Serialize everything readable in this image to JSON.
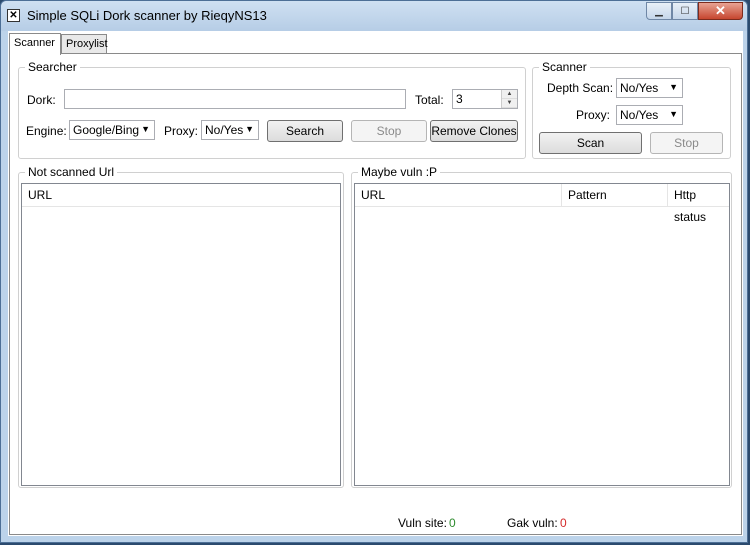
{
  "window": {
    "title": "Simple SQLi Dork scanner by RieqyNS13",
    "icon": "app-icon",
    "controls": {
      "minimize": "minimize-icon",
      "maximize": "maximize-icon",
      "close": "close-icon"
    }
  },
  "tabs": [
    {
      "label": "Scanner",
      "active": true
    },
    {
      "label": "Proxylist",
      "active": false
    }
  ],
  "searcher": {
    "legend": "Searcher",
    "dork_label": "Dork:",
    "dork_value": "",
    "total_label": "Total:",
    "total_value": "3",
    "engine_label": "Engine:",
    "engine_value": "Google/Bing",
    "proxy_label": "Proxy:",
    "proxy_value": "No/Yes",
    "search_button": "Search",
    "stop_button": "Stop",
    "remove_clones_button": "Remove Clones"
  },
  "scanner": {
    "legend": "Scanner",
    "depth_label": "Depth Scan:",
    "depth_value": "No/Yes",
    "proxy_label": "Proxy:",
    "proxy_value": "No/Yes",
    "scan_button": "Scan",
    "stop_button": "Stop"
  },
  "not_scanned": {
    "legend": "Not scanned Url",
    "columns": [
      "URL"
    ]
  },
  "maybe_vuln": {
    "legend": "Maybe vuln :P",
    "columns": [
      "URL",
      "Pattern",
      "Http status"
    ]
  },
  "status": {
    "vuln_label": "Vuln site:",
    "vuln_value": "0",
    "vuln_color": "#2e8b2e",
    "gak_label": "Gak vuln:",
    "gak_value": "0",
    "gak_color": "#d42a2a"
  }
}
